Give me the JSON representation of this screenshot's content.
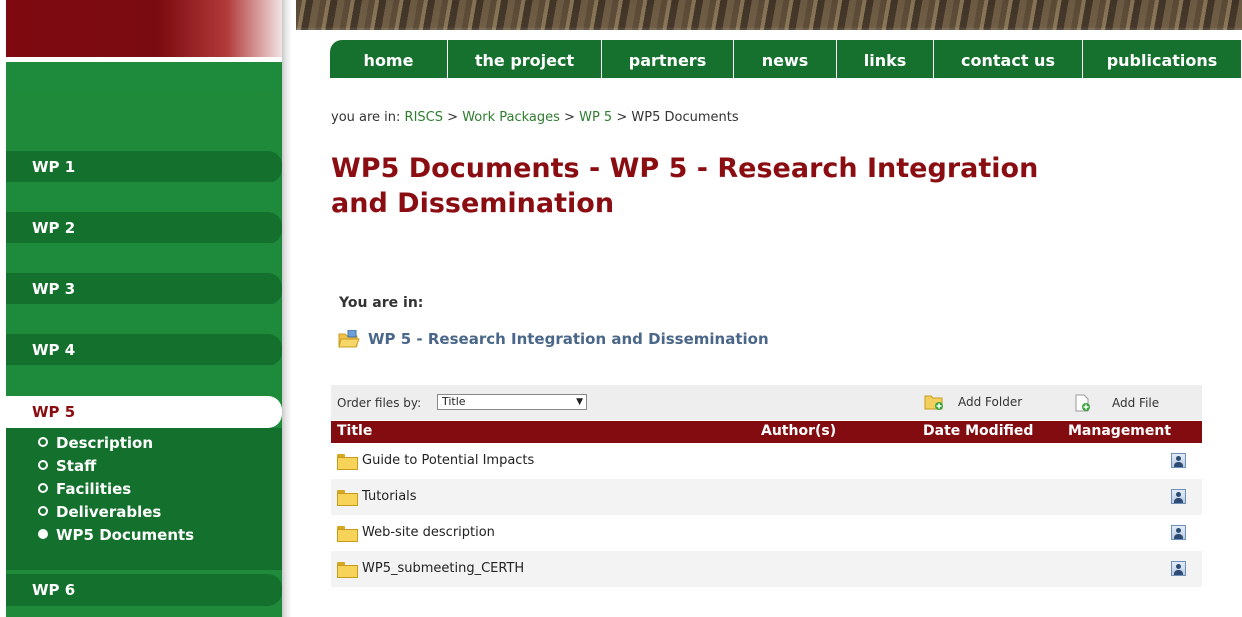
{
  "colors": {
    "green": "#15712d",
    "maroon": "#830c11",
    "link_green": "#2f7d2f",
    "folder_link": "#4a6789"
  },
  "topnav": [
    "home",
    "the project",
    "partners",
    "news",
    "links",
    "contact us",
    "publications"
  ],
  "sidebar": {
    "items": [
      "WP 1",
      "WP 2",
      "WP 3",
      "WP 4",
      "WP 5",
      "WP 6"
    ],
    "active": "WP 5",
    "subitems": [
      {
        "label": "Description",
        "current": false
      },
      {
        "label": "Staff",
        "current": false
      },
      {
        "label": "Facilities",
        "current": false
      },
      {
        "label": "Deliverables",
        "current": false
      },
      {
        "label": "WP5 Documents",
        "current": true
      }
    ]
  },
  "breadcrumb": {
    "prefix": "you are in:",
    "links": [
      "RISCS",
      "Work Packages",
      "WP 5"
    ],
    "current": "WP5 Documents"
  },
  "page_title": "WP5 Documents - WP 5 - Research Integration and Dissemination",
  "location": {
    "label": "You are in:",
    "folder": "WP 5 - Research Integration and Dissemination"
  },
  "toolbar": {
    "order_label": "Order files by:",
    "order_value": "Title",
    "add_folder": "Add Folder",
    "add_file": "Add File"
  },
  "table": {
    "columns": [
      "Title",
      "Author(s)",
      "Date Modified",
      "Management"
    ],
    "rows": [
      "Guide to Potential Impacts",
      "Tutorials",
      "Web-site description",
      "WP5_submeeting_CERTH"
    ]
  }
}
